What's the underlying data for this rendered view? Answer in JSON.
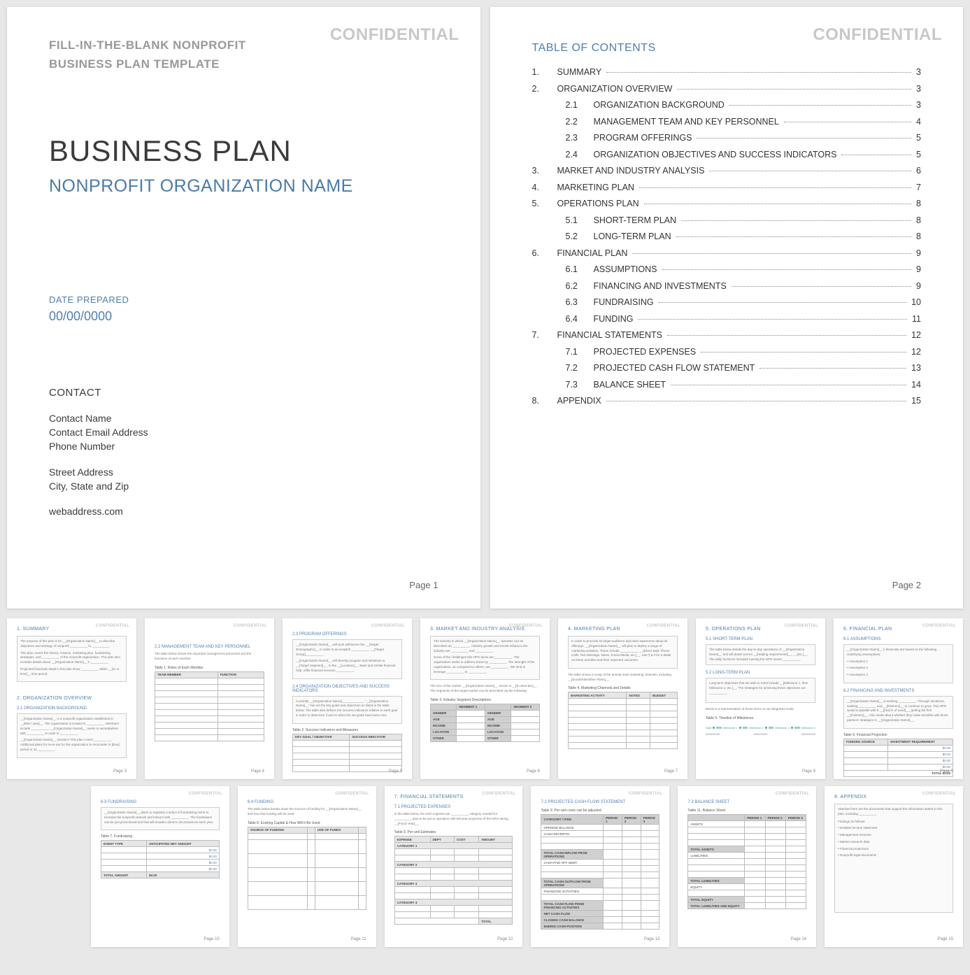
{
  "confidential": "CONFIDENTIAL",
  "cover": {
    "template_line1": "FILL-IN-THE-BLANK NONPROFIT",
    "template_line2": "BUSINESS PLAN TEMPLATE",
    "title": "BUSINESS PLAN",
    "org_name": "NONPROFIT ORGANIZATION NAME",
    "date_label": "DATE PREPARED",
    "date_value": "00/00/0000",
    "contact_h": "CONTACT",
    "contact": [
      "Contact Name",
      "Contact Email Address",
      "Phone Number"
    ],
    "address": [
      "Street Address",
      "City, State and Zip"
    ],
    "web": "webaddress.com",
    "page": "Page 1"
  },
  "toc": {
    "title": "TABLE OF CONTENTS",
    "rows": [
      {
        "n": "1.",
        "sub": "",
        "t": "SUMMARY",
        "p": "3"
      },
      {
        "n": "2.",
        "sub": "",
        "t": "ORGANIZATION OVERVIEW",
        "p": "3"
      },
      {
        "n": "",
        "sub": "2.1",
        "t": "ORGANIZATION BACKGROUND",
        "p": "3"
      },
      {
        "n": "",
        "sub": "2.2",
        "t": "MANAGEMENT TEAM AND KEY PERSONNEL",
        "p": "4"
      },
      {
        "n": "",
        "sub": "2.3",
        "t": "PROGRAM OFFERINGS",
        "p": "5"
      },
      {
        "n": "",
        "sub": "2.4",
        "t": "ORGANIZATION OBJECTIVES AND SUCCESS INDICATORS",
        "p": "5"
      },
      {
        "n": "3.",
        "sub": "",
        "t": "MARKET AND INDUSTRY ANALYSIS",
        "p": "6"
      },
      {
        "n": "4.",
        "sub": "",
        "t": "MARKETING PLAN",
        "p": "7"
      },
      {
        "n": "5.",
        "sub": "",
        "t": "OPERATIONS PLAN",
        "p": "8"
      },
      {
        "n": "",
        "sub": "5.1",
        "t": "SHORT-TERM PLAN",
        "p": "8"
      },
      {
        "n": "",
        "sub": "5.2",
        "t": "LONG-TERM PLAN",
        "p": "8"
      },
      {
        "n": "6.",
        "sub": "",
        "t": "FINANCIAL PLAN",
        "p": "9"
      },
      {
        "n": "",
        "sub": "6.1",
        "t": "ASSUMPTIONS",
        "p": "9"
      },
      {
        "n": "",
        "sub": "6.2",
        "t": "FINANCING AND INVESTMENTS",
        "p": "9"
      },
      {
        "n": "",
        "sub": "6.3",
        "t": "FUNDRAISING",
        "p": "10"
      },
      {
        "n": "",
        "sub": "6.4",
        "t": "FUNDING",
        "p": "11"
      },
      {
        "n": "7.",
        "sub": "",
        "t": "FINANCIAL STATEMENTS",
        "p": "12"
      },
      {
        "n": "",
        "sub": "7.1",
        "t": "PROJECTED EXPENSES",
        "p": "12"
      },
      {
        "n": "",
        "sub": "7.2",
        "t": "PROJECTED CASH FLOW STATEMENT",
        "p": "13"
      },
      {
        "n": "",
        "sub": "7.3",
        "t": "BALANCE SHEET",
        "p": "14"
      },
      {
        "n": "8.",
        "sub": "",
        "t": "APPENDIX",
        "p": "15"
      }
    ],
    "page": "Page 2"
  },
  "thumbs": {
    "p3": {
      "h1": "1. SUMMARY",
      "t1": "The purpose of this plan is for __[Organization Name]__ to describe objectives and strategy of nonprofit __________ to __________.",
      "t2": "This plan covers the history, mission, marketing plan, fundraising strategies, and __________ of the nonprofit organization. This plan also includes details about __[Organization Name]__'s __________.",
      "t3": "Projected financials detail in this plan show __________ within __[% or time]__ time period.",
      "h2": "2. ORGANIZATION OVERVIEW",
      "h3": "2.1   ORGANIZATION BACKGROUND",
      "t4": "__[Organization Name]__ is a nonprofit organization established in __[MM / year]__. The organization is located in __________. Members include __________. __[Organization Name]__ seeks to serve/partner with __________ in order to __________.",
      "t5": "__[Organization Name]__ mission? This plan covers __________. Additional plans for more are for the organization to reconsider in [time] period or as __________.",
      "page": "Page 3"
    },
    "p4": {
      "h": "2.2   MANAGEMENT TEAM AND KEY PERSONNEL",
      "t": "The table below shows the important management personnel and the functions of each member.",
      "lbl": "Table 1. Roles of Each Member",
      "cols": [
        "TEAM MEMBER",
        "FUNCTION"
      ],
      "page": "Page 4"
    },
    "p5": {
      "h1": "2.3   PROGRAM OFFERINGS",
      "t1": "__[Organization Name]__ will work with/serve the __[Target Demographic]__ in order to accomplish __________. __[Target Group]__________.",
      "t2": "__[Organization Name]__ will develop program and initiatives to __[Target Segment]__. In the __[Location]__. Bank and similar financial help. Offer financial services __________.",
      "h2": "2.4   ORGANIZATION OBJECTIVES AND SUCCESS INDICATORS",
      "t3": "Currently __[Organization Name]__ __________. '__[Organization Name]__' has set the key goals and objectives as listed in the table below. The table also defines the success indicators relative to each goal in order to determine if and or when the set goals have been met.",
      "lbl": "Table 2. Success Indicators and Measures",
      "cols": [
        "KEY GOAL / OBJECTIVE",
        "SUCCESS INDICATOR"
      ],
      "page": "Page 5"
    },
    "p6": {
      "h": "3. MARKET AND INDUSTRY ANALYSIS",
      "t1": "The industry in which __[Organization Name]__ operates can be described as __________. Industry growth and trends influence the industry are __________ and __________.",
      "t2": "Some of the challenges this NPO faces are __________. The organization seeks to address these by __________. The strength of the organization, as compared to others, are __________. We tend to leverage __________ to __________.",
      "t3": "The size of the market __[Organization Name]__ serves is __[$ value $xx]__. The segments of the target market can be described via the following:",
      "lbl": "Table 3. Industry Segment Descriptions",
      "cols": [
        "SEGMENT 1",
        "",
        "SEGMENT 2",
        ""
      ],
      "rows": [
        "GENDER",
        "AGE",
        "INCOME",
        "LOCATION",
        "OTHER"
      ],
      "page": "Page 6"
    },
    "p7": {
      "h": "4. MARKETING PLAN",
      "t1": "In order to promote its target audience and raise awareness about its offerings, __[Organization Name]__ will plan to deploy a range of marketing activities. These include __________, __[Direct Mail, Phone Calls, Text Message, News, Social Media, etc.]__. See § 6.3 for a detail on these activities and their expected outcomes.",
      "t2": "The table shows a recap of the annual main marketing channels, including __[Social/Site/Other Plans]__.",
      "lbl": "Table 4. Marketing Channels and Details",
      "cols": [
        "MARKETING ACTIVITY",
        "NOTES",
        "BUDGET"
      ],
      "page": "Page 7"
    },
    "p8": {
      "h": "5. OPERATIONS PLAN",
      "h1": "5.1   SHORT-TERM PLAN",
      "t1": "The table below details the day-to-day operations of __[Organization Name]__ and will detail current __[reading requirements]__, __[etc.]__. The daily functions included running the NPO needs __________.",
      "h2": "5.2   LONG-TERM PLAN",
      "t2": "Long-term objectives that we wish to meet include __[Milestone 1, then Milestone 2, etc.]__. The strategies for achieving these objectives are __________.",
      "t3": "Below is a representation of these items on an integrated scale.",
      "lbl": "Table 5. Timeline of Milestones",
      "ms": [
        "Start",
        "Milestone 1",
        "Milestone 2",
        "Milestone 3",
        "Milestone 4"
      ],
      "dates": [
        "00/00/0000",
        "00/00/0000",
        "00/00/0000"
      ],
      "page": "Page 8"
    },
    "p9": {
      "h": "6. FINANCIAL PLAN",
      "h1": "6.1   ASSUMPTIONS",
      "t1": "__[Organization Name]__'s financials are based on the following underlying assumptions:",
      "bul": [
        "Assumption 1",
        "Assumption 2",
        "Assumption 3"
      ],
      "h2": "6.2   FINANCING AND INVESTMENTS",
      "t2": "__[Organization Name]__ is seeking __________. Through donations, seeking __________ and __[Partners]__ to continue to grow. This NPO would in parallel with K __[fund is of need]__, getting the first __[Partners]__. Also seeks about whether they make sensible with those partners' strategies in __[Organization Name]__.",
      "lbl": "Table 6. Financial Projection",
      "cols": [
        "FUNDING SOURCE",
        "INVESTMENT REQUIREMENT"
      ],
      "amt": "$0.00",
      "total": "TOTAL  $0.00",
      "page": "Page 9"
    },
    "p10": {
      "h": "6.3   FUNDRAISING",
      "t1": "__[Organization Name]__ plans to regularly conduct of fundraising event to increase the nonprofit network and interact with __________. The fundraisers can be just promotional tool that will broaden donors circumstances each year.",
      "lbl": "Table 7. Fundraising",
      "cols": [
        "EVENT TYPE",
        "ANTICIPATED NET AMOUNT"
      ],
      "amt": "$0.00",
      "total_l": "TOTAL AMOUNT",
      "total_v": "$0.00",
      "page": "Page 10"
    },
    "p11": {
      "h": "6.4   FUNDING",
      "t1": "The table below breaks down the sources of funding for __[Organization Name]__ and how that funding will be used.",
      "lbl": "Table 8. Existing Capital & How Will It Be Used",
      "cols": [
        "SOURCE OF FUNDING",
        "",
        "USE OF FUNDS",
        ""
      ],
      "page": "Page 11"
    },
    "p12": {
      "h": "7. FINANCIAL STATEMENTS",
      "h1": "7.1   PROJECTED EXPENSES",
      "t1": "In the table below, list each expense per __________ category needed for __________ plan to be put to operation with full-year projection of the NPO during __[Fiscal Year]__.",
      "lbl": "Table 9. Per-unit Estimates",
      "cols": [
        "EXPENSE",
        "DEPT",
        "COST",
        "AMOUNT"
      ],
      "cats": [
        "CATEGORY 1",
        "CATEGORY 2",
        "CATEGORY 3",
        "CATEGORY 4"
      ],
      "total": "TOTAL",
      "page": "Page 12"
    },
    "p13": {
      "h": "7.2   PROJECTED CASH FLOW STATEMENT",
      "t": "Table 9. Per-unit costs can be adjusted.",
      "cols": [
        "CATEGORY / ITEM",
        "PERIOD 1",
        "PERIOD 2",
        "PERIOD 3"
      ],
      "sections": [
        "OPENING BALANCE",
        "CASH RECEIPTS:",
        "TOTAL CASH INFLOW FROM OPERATIONS",
        "CASH PAID OFF DEBT:",
        "TOTAL CASH OUTFLOW FROM OPERATIONS",
        "FINANCING ACTIVITIES:",
        "TOTAL CASH FLOW FROM FINANCING ACTIVITIES",
        "NET CASH FLOW",
        "CLOSING CASH BALANCE",
        "ENDING CASH POSITION"
      ],
      "page": "Page 13"
    },
    "p14": {
      "h": "7.3   BALANCE SHEET",
      "t": "Table 11. Balance Sheet",
      "cols": [
        "",
        "PERIOD 1",
        "PERIOD 2",
        "PERIOD 3"
      ],
      "sections": [
        "ASSETS",
        "TOTAL ASSETS",
        "LIABILITIES",
        "TOTAL LIABILITIES",
        "EQUITY",
        "TOTAL EQUITY",
        "TOTAL LIABILITIES AND EQUITY"
      ],
      "page": "Page 14"
    },
    "p15": {
      "h": "8. APPENDIX",
      "t": "Attached here are the documents that support the information stated in this plan, including __________.",
      "lead": "Findings as follows:",
      "bul": [
        "Detailed income statement",
        "Management resumes",
        "Market research data",
        "Financial projections",
        "Nonprofit legal documents"
      ],
      "page": "Page 15"
    }
  }
}
